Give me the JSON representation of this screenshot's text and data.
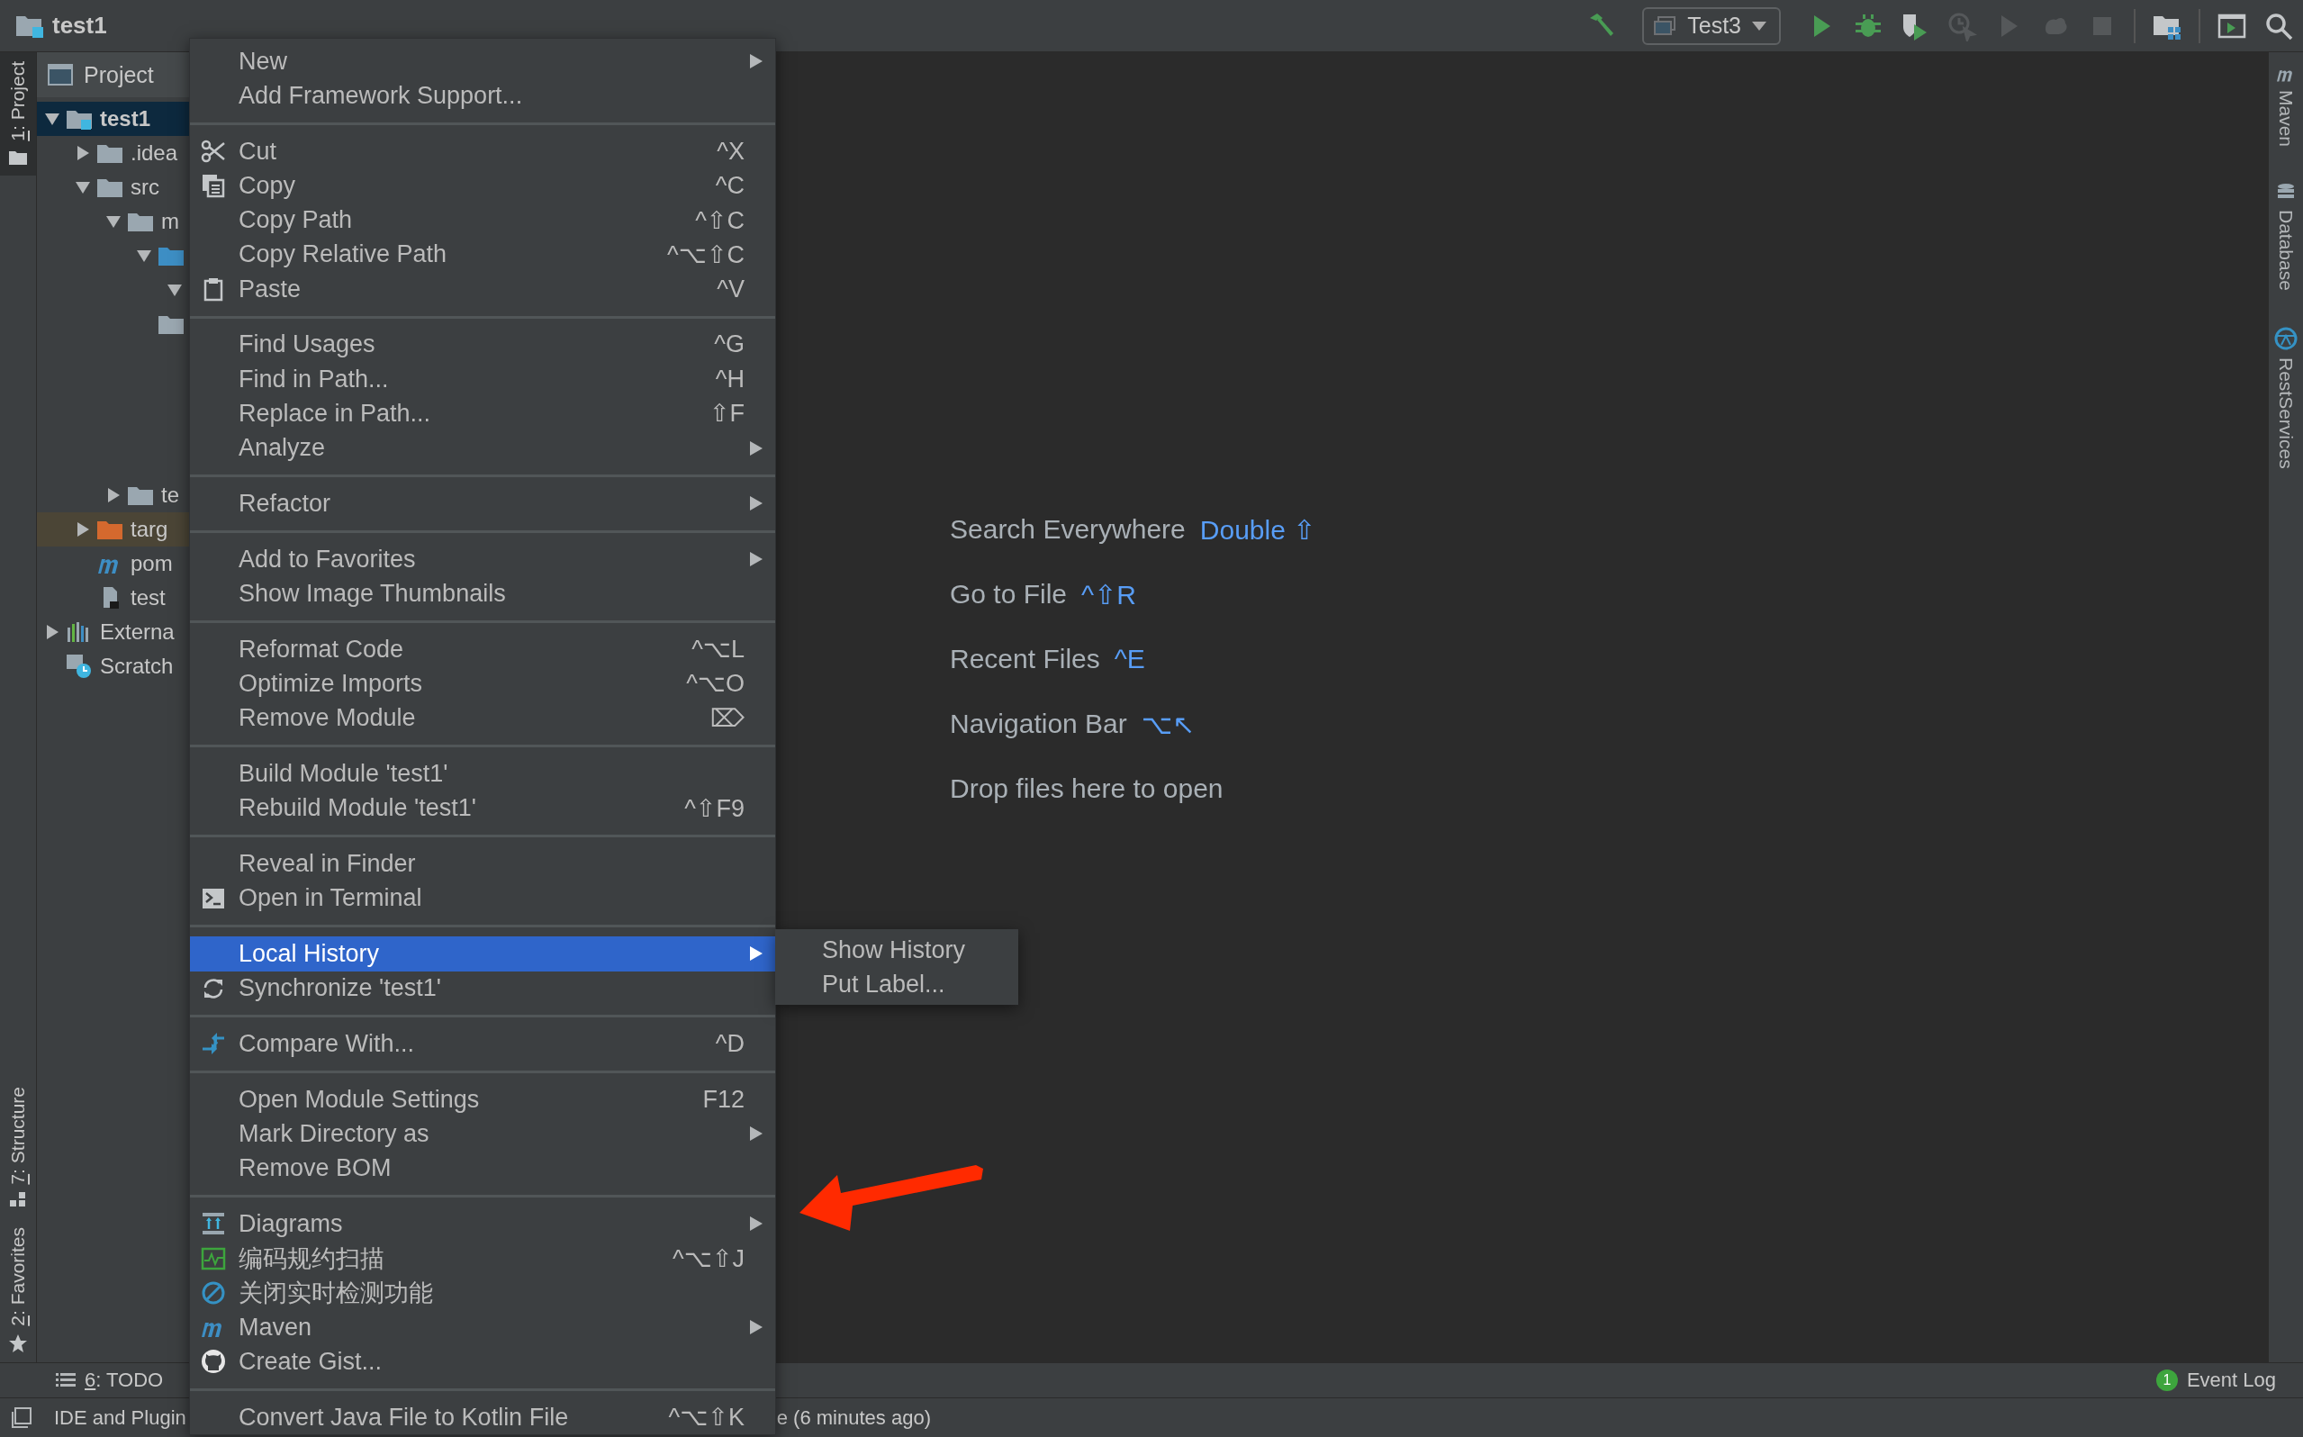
{
  "title_bar": {
    "project": "test1"
  },
  "toolbar": [
    {
      "kind": "hammer",
      "disabled": false
    },
    {
      "kind": "run-config",
      "label": "Test3",
      "disabled": false
    },
    {
      "kind": "run",
      "disabled": false
    },
    {
      "kind": "debug",
      "disabled": false
    },
    {
      "kind": "coverage",
      "disabled": false
    },
    {
      "kind": "profile",
      "disabled": true
    },
    {
      "kind": "run",
      "disabled": true
    },
    {
      "kind": "blob",
      "disabled": true
    },
    {
      "kind": "stop",
      "disabled": true
    },
    {
      "kind": "separator"
    },
    {
      "kind": "project-structure",
      "disabled": false
    },
    {
      "kind": "separator"
    },
    {
      "kind": "terminal",
      "disabled": false
    },
    {
      "kind": "search",
      "disabled": false
    }
  ],
  "left_tool_tabs": [
    {
      "key": "1",
      "label": ": Project",
      "kind": "folder",
      "selected": true
    },
    {
      "key": "7",
      "label": ": Structure",
      "kind": "structure",
      "selected": false
    },
    {
      "key": "2",
      "label": ": Favorites",
      "kind": "star",
      "selected": false
    }
  ],
  "project_panel": {
    "title": "Project",
    "tree": [
      {
        "name": "test1",
        "kind": "project",
        "expanded": true,
        "selected": true,
        "children": [
          {
            "name": ".idea",
            "kind": "folder",
            "expanded": false,
            "selected": false
          },
          {
            "name": "src",
            "kind": "folder",
            "expanded": true,
            "selected": false,
            "children": [
              {
                "name": "m",
                "kind": "folder",
                "expanded": true,
                "selected": false,
                "children": [
                  {
                    "kind": "source",
                    "expanded": true,
                    "selected": false,
                    "children": [
                      {
                        "expanded": true,
                        "selected": false
                      }
                    ]
                  },
                  {
                    "kind": "folder",
                    "selected": false
                  }
                ]
              },
              {
                "name": "te",
                "kind": "folder",
                "expanded": false,
                "selected": false
              }
            ]
          },
          {
            "name": "targ",
            "kind": "excluded",
            "expanded": false,
            "selected": false
          },
          {
            "name": "pom",
            "kind": "maven",
            "selected": false
          },
          {
            "name": "test",
            "kind": "iml",
            "selected": false
          }
        ]
      },
      {
        "name": "Externa",
        "kind": "libraries",
        "expanded": false,
        "selected": false
      },
      {
        "name": "Scratch",
        "kind": "scratches",
        "selected": false
      }
    ]
  },
  "context_menu": [
    [
      {
        "label": "New",
        "kind": "plain",
        "submenu": true,
        "selected": false
      },
      {
        "label": "Add Framework Support...",
        "kind": "plain",
        "selected": false
      }
    ],
    [
      {
        "label": "Cut",
        "shortcut": "^X",
        "kind": "scissors",
        "selected": false
      },
      {
        "label": "Copy",
        "shortcut": "^C",
        "kind": "copy",
        "selected": false
      },
      {
        "label": "Copy Path",
        "shortcut": "^⇧C",
        "kind": "plain",
        "selected": false
      },
      {
        "label": "Copy Relative Path",
        "shortcut": "^⌥⇧C",
        "kind": "plain",
        "selected": false
      },
      {
        "label": "Paste",
        "shortcut": "^V",
        "kind": "paste",
        "selected": false
      }
    ],
    [
      {
        "label": "Find Usages",
        "shortcut": "^G",
        "kind": "plain",
        "selected": false
      },
      {
        "label": "Find in Path...",
        "shortcut": "^H",
        "kind": "plain",
        "selected": false
      },
      {
        "label": "Replace in Path...",
        "shortcut": "⇧F",
        "kind": "plain",
        "selected": false
      },
      {
        "label": "Analyze",
        "kind": "plain",
        "submenu": true,
        "selected": false
      }
    ],
    [
      {
        "label": "Refactor",
        "kind": "plain",
        "submenu": true,
        "selected": false
      }
    ],
    [
      {
        "label": "Add to Favorites",
        "kind": "plain",
        "submenu": true,
        "selected": false
      },
      {
        "label": "Show Image Thumbnails",
        "kind": "plain",
        "selected": false
      }
    ],
    [
      {
        "label": "Reformat Code",
        "shortcut": "^⌥L",
        "kind": "plain",
        "selected": false
      },
      {
        "label": "Optimize Imports",
        "shortcut": "^⌥O",
        "kind": "plain",
        "selected": false
      },
      {
        "label": "Remove Module",
        "shortcut": "⌦",
        "kind": "plain",
        "selected": false
      }
    ],
    [
      {
        "label": "Build Module 'test1'",
        "kind": "plain",
        "selected": false
      },
      {
        "label": "Rebuild Module 'test1'",
        "shortcut": "^⇧F9",
        "kind": "plain",
        "selected": false
      }
    ],
    [
      {
        "label": "Reveal in Finder",
        "kind": "plain",
        "selected": false
      },
      {
        "label": "Open in Terminal",
        "kind": "terminal",
        "selected": false
      }
    ],
    [
      {
        "label": "Local History",
        "kind": "plain",
        "submenu": true,
        "selected": true
      },
      {
        "label": "Synchronize 'test1'",
        "kind": "sync",
        "selected": false
      }
    ],
    [
      {
        "label": "Compare With...",
        "shortcut": "^D",
        "kind": "compare",
        "selected": false
      }
    ],
    [
      {
        "label": "Open Module Settings",
        "shortcut": "F12",
        "kind": "plain",
        "selected": false
      },
      {
        "label": "Mark Directory as",
        "kind": "plain",
        "submenu": true,
        "selected": false
      },
      {
        "label": "Remove BOM",
        "kind": "plain",
        "selected": false
      }
    ],
    [
      {
        "label": "Diagrams",
        "submenu": true,
        "kind": "diagram",
        "selected": false
      },
      {
        "label": "编码规约扫描",
        "shortcut": "^⌥⇧J",
        "kind": "scan",
        "selected": false
      },
      {
        "label": "关闭实时检测功能",
        "kind": "ban",
        "selected": false
      },
      {
        "label": "Maven",
        "submenu": true,
        "kind": "m",
        "selected": false
      },
      {
        "label": "Create Gist...",
        "kind": "cat",
        "selected": false
      }
    ],
    [
      {
        "label": "Convert Java File to Kotlin File",
        "shortcut": "^⌥⇧K",
        "kind": "plain",
        "selected": false
      }
    ]
  ],
  "submenu": [
    {
      "label": "Show History",
      "selected": false
    },
    {
      "label": "Put Label...",
      "selected": false
    }
  ],
  "welcome": [
    {
      "label": "Search Everywhere",
      "shortcut": "Double ⇧"
    },
    {
      "label": "Go to File",
      "shortcut": "^⇧R"
    },
    {
      "label": "Recent Files",
      "shortcut": "^E"
    },
    {
      "label": "Navigation Bar",
      "shortcut": "⌥↖"
    },
    {
      "label": "Drop files here to open"
    }
  ],
  "right_tool_tabs": [
    {
      "label": "Maven",
      "kind": "m"
    },
    {
      "label": "Database",
      "kind": "database"
    },
    {
      "label": "RestServices",
      "kind": "globe"
    }
  ],
  "bottom_bar": {
    "left": [
      {
        "key": "6",
        "label": ": TODO"
      }
    ],
    "right": [
      {
        "badge": "1",
        "label": "Event Log"
      }
    ]
  },
  "status_bar": {
    "left": "IDE and Plugin",
    "right": "e (6 minutes ago)"
  }
}
